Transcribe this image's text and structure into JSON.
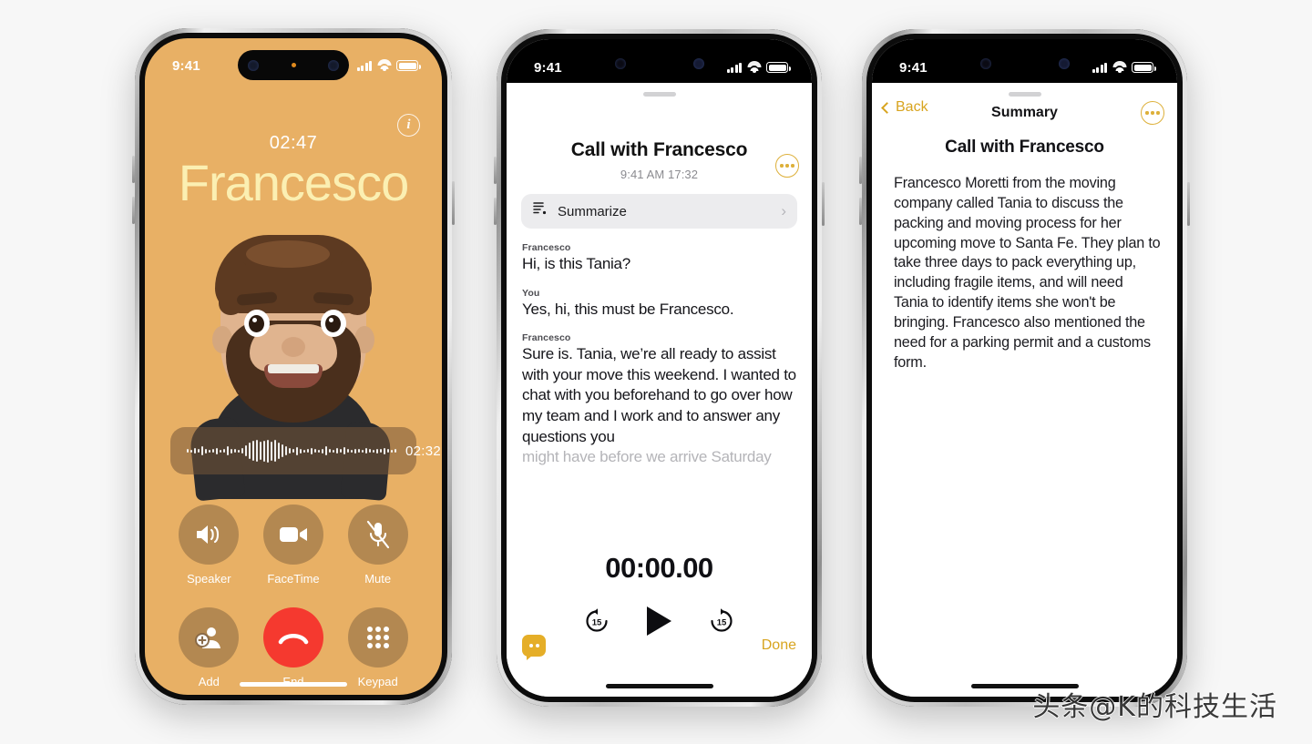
{
  "background_color": "#f7f7f7",
  "accent_gold": "#d8a41f",
  "call_screen": {
    "status_bar": {
      "time": "9:41",
      "signal_icon": "cellular-bars-icon",
      "wifi_icon": "wifi-icon",
      "battery_icon": "battery-icon"
    },
    "info_button": "i",
    "duration": "02:47",
    "caller_name": "Francesco",
    "avatar": "memoji-avatar",
    "recording": {
      "time": "02:32",
      "stop_label": "stop-recording"
    },
    "controls": [
      {
        "label": "Speaker",
        "icon": "speaker-icon"
      },
      {
        "label": "FaceTime",
        "icon": "video-camera-icon"
      },
      {
        "label": "Mute",
        "icon": "microphone-muted-icon"
      },
      {
        "label": "Add",
        "icon": "add-person-icon"
      },
      {
        "label": "End",
        "icon": "end-call-icon"
      },
      {
        "label": "Keypad",
        "icon": "keypad-icon"
      }
    ]
  },
  "transcript_screen": {
    "status_bar": {
      "time": "9:41"
    },
    "title": "Call with Francesco",
    "subtitle": "9:41 AM  17:32",
    "more_button": "more-options",
    "summarize": {
      "label": "Summarize",
      "icon": "summarize-document-icon",
      "chevron": "›"
    },
    "messages": [
      {
        "speaker": "Francesco",
        "text": "Hi, is this Tania?",
        "faded": false
      },
      {
        "speaker": "You",
        "text": "Yes, hi, this must be Francesco.",
        "faded": false
      },
      {
        "speaker": "Francesco",
        "text": "Sure is. Tania, we’re all ready to assist with your move this weekend. I wanted to chat with you beforehand to go over how my team and I work and to answer any questions you ",
        "faded": false
      },
      {
        "speaker": "",
        "text": "might have before we arrive Saturday",
        "faded": true
      }
    ],
    "player": {
      "time": "00:00.00",
      "back_15": "15",
      "forward_15": "15",
      "play_icon": "play-icon"
    },
    "live_transcription_icon": "live-transcription-icon",
    "done_label": "Done"
  },
  "summary_screen": {
    "status_bar": {
      "time": "9:41"
    },
    "back_label": "Back",
    "nav_title": "Summary",
    "more_button": "more-options",
    "title": "Call with Francesco",
    "body": "Francesco Moretti from the moving company called Tania to discuss the packing and moving process for her upcoming move to Santa Fe. They plan to take three days to pack everything up, including fragile items, and will need Tania to identify items she won't be bringing. Francesco also mentioned the need for a parking permit and a customs form."
  },
  "watermark": "头条@K的科技生活"
}
